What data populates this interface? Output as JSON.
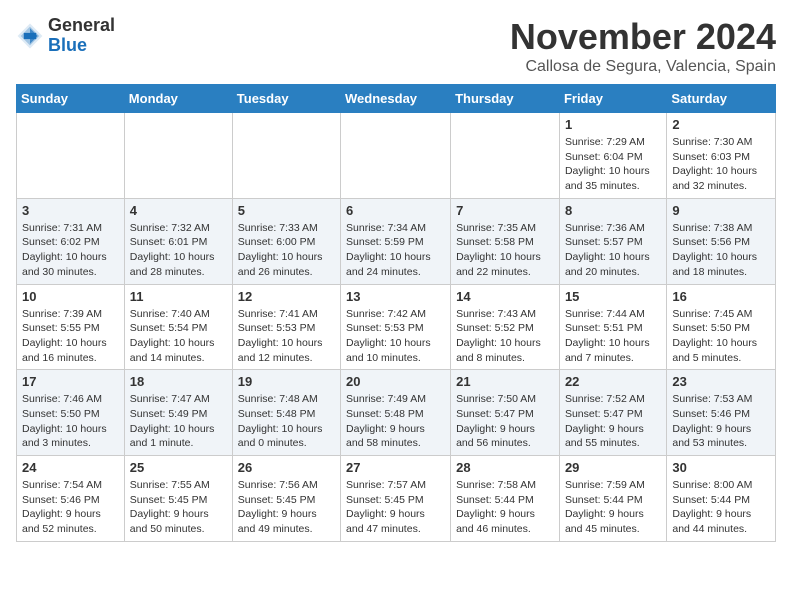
{
  "header": {
    "logo_line1": "General",
    "logo_line2": "Blue",
    "month": "November 2024",
    "location": "Callosa de Segura, Valencia, Spain"
  },
  "weekdays": [
    "Sunday",
    "Monday",
    "Tuesday",
    "Wednesday",
    "Thursday",
    "Friday",
    "Saturday"
  ],
  "weeks": [
    [
      {
        "day": "",
        "info": ""
      },
      {
        "day": "",
        "info": ""
      },
      {
        "day": "",
        "info": ""
      },
      {
        "day": "",
        "info": ""
      },
      {
        "day": "",
        "info": ""
      },
      {
        "day": "1",
        "info": "Sunrise: 7:29 AM\nSunset: 6:04 PM\nDaylight: 10 hours and 35 minutes."
      },
      {
        "day": "2",
        "info": "Sunrise: 7:30 AM\nSunset: 6:03 PM\nDaylight: 10 hours and 32 minutes."
      }
    ],
    [
      {
        "day": "3",
        "info": "Sunrise: 7:31 AM\nSunset: 6:02 PM\nDaylight: 10 hours and 30 minutes."
      },
      {
        "day": "4",
        "info": "Sunrise: 7:32 AM\nSunset: 6:01 PM\nDaylight: 10 hours and 28 minutes."
      },
      {
        "day": "5",
        "info": "Sunrise: 7:33 AM\nSunset: 6:00 PM\nDaylight: 10 hours and 26 minutes."
      },
      {
        "day": "6",
        "info": "Sunrise: 7:34 AM\nSunset: 5:59 PM\nDaylight: 10 hours and 24 minutes."
      },
      {
        "day": "7",
        "info": "Sunrise: 7:35 AM\nSunset: 5:58 PM\nDaylight: 10 hours and 22 minutes."
      },
      {
        "day": "8",
        "info": "Sunrise: 7:36 AM\nSunset: 5:57 PM\nDaylight: 10 hours and 20 minutes."
      },
      {
        "day": "9",
        "info": "Sunrise: 7:38 AM\nSunset: 5:56 PM\nDaylight: 10 hours and 18 minutes."
      }
    ],
    [
      {
        "day": "10",
        "info": "Sunrise: 7:39 AM\nSunset: 5:55 PM\nDaylight: 10 hours and 16 minutes."
      },
      {
        "day": "11",
        "info": "Sunrise: 7:40 AM\nSunset: 5:54 PM\nDaylight: 10 hours and 14 minutes."
      },
      {
        "day": "12",
        "info": "Sunrise: 7:41 AM\nSunset: 5:53 PM\nDaylight: 10 hours and 12 minutes."
      },
      {
        "day": "13",
        "info": "Sunrise: 7:42 AM\nSunset: 5:53 PM\nDaylight: 10 hours and 10 minutes."
      },
      {
        "day": "14",
        "info": "Sunrise: 7:43 AM\nSunset: 5:52 PM\nDaylight: 10 hours and 8 minutes."
      },
      {
        "day": "15",
        "info": "Sunrise: 7:44 AM\nSunset: 5:51 PM\nDaylight: 10 hours and 7 minutes."
      },
      {
        "day": "16",
        "info": "Sunrise: 7:45 AM\nSunset: 5:50 PM\nDaylight: 10 hours and 5 minutes."
      }
    ],
    [
      {
        "day": "17",
        "info": "Sunrise: 7:46 AM\nSunset: 5:50 PM\nDaylight: 10 hours and 3 minutes."
      },
      {
        "day": "18",
        "info": "Sunrise: 7:47 AM\nSunset: 5:49 PM\nDaylight: 10 hours and 1 minute."
      },
      {
        "day": "19",
        "info": "Sunrise: 7:48 AM\nSunset: 5:48 PM\nDaylight: 10 hours and 0 minutes."
      },
      {
        "day": "20",
        "info": "Sunrise: 7:49 AM\nSunset: 5:48 PM\nDaylight: 9 hours and 58 minutes."
      },
      {
        "day": "21",
        "info": "Sunrise: 7:50 AM\nSunset: 5:47 PM\nDaylight: 9 hours and 56 minutes."
      },
      {
        "day": "22",
        "info": "Sunrise: 7:52 AM\nSunset: 5:47 PM\nDaylight: 9 hours and 55 minutes."
      },
      {
        "day": "23",
        "info": "Sunrise: 7:53 AM\nSunset: 5:46 PM\nDaylight: 9 hours and 53 minutes."
      }
    ],
    [
      {
        "day": "24",
        "info": "Sunrise: 7:54 AM\nSunset: 5:46 PM\nDaylight: 9 hours and 52 minutes."
      },
      {
        "day": "25",
        "info": "Sunrise: 7:55 AM\nSunset: 5:45 PM\nDaylight: 9 hours and 50 minutes."
      },
      {
        "day": "26",
        "info": "Sunrise: 7:56 AM\nSunset: 5:45 PM\nDaylight: 9 hours and 49 minutes."
      },
      {
        "day": "27",
        "info": "Sunrise: 7:57 AM\nSunset: 5:45 PM\nDaylight: 9 hours and 47 minutes."
      },
      {
        "day": "28",
        "info": "Sunrise: 7:58 AM\nSunset: 5:44 PM\nDaylight: 9 hours and 46 minutes."
      },
      {
        "day": "29",
        "info": "Sunrise: 7:59 AM\nSunset: 5:44 PM\nDaylight: 9 hours and 45 minutes."
      },
      {
        "day": "30",
        "info": "Sunrise: 8:00 AM\nSunset: 5:44 PM\nDaylight: 9 hours and 44 minutes."
      }
    ]
  ]
}
